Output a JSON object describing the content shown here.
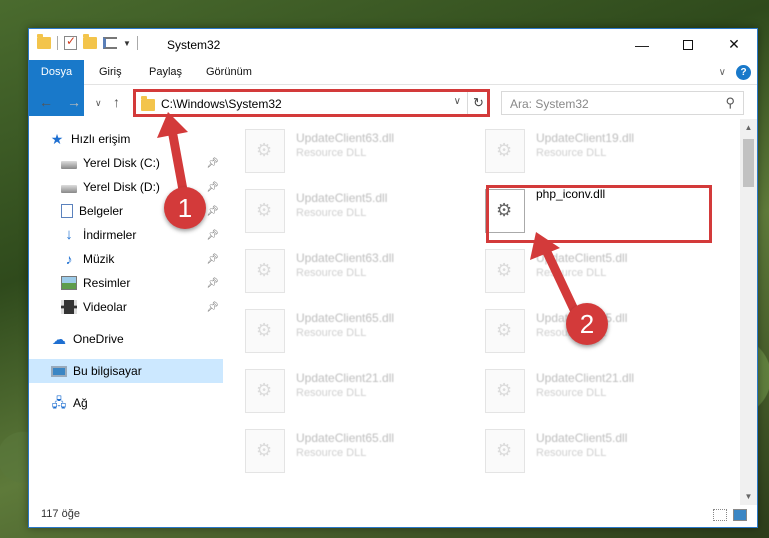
{
  "window": {
    "title": "System32",
    "controls": {
      "minimize": "—",
      "maximize": "",
      "close": "✕"
    }
  },
  "ribbon": {
    "tabs": [
      "Dosya",
      "Giriş",
      "Paylaş",
      "Görünüm"
    ],
    "help_label": "?"
  },
  "address": {
    "path": "C:\\Windows\\System32",
    "search_placeholder": "Ara: System32"
  },
  "sidebar": {
    "items": [
      {
        "label": "Hızlı erişim",
        "icon": "star-icon"
      },
      {
        "label": "Yerel Disk (C:)",
        "icon": "drive-icon",
        "pinned": true
      },
      {
        "label": "Yerel Disk (D:)",
        "icon": "drive-icon",
        "pinned": true
      },
      {
        "label": "Belgeler",
        "icon": "documents-icon",
        "pinned": true
      },
      {
        "label": "İndirmeler",
        "icon": "downloads-icon",
        "pinned": true
      },
      {
        "label": "Müzik",
        "icon": "music-icon",
        "pinned": true
      },
      {
        "label": "Resimler",
        "icon": "pictures-icon",
        "pinned": true
      },
      {
        "label": "Videolar",
        "icon": "videos-icon",
        "pinned": true
      },
      {
        "label": "OneDrive",
        "icon": "cloud-icon"
      },
      {
        "label": "Bu bilgisayar",
        "icon": "computer-icon",
        "selected": true
      },
      {
        "label": "Ağ",
        "icon": "network-icon"
      }
    ]
  },
  "files": {
    "left": [
      {
        "name": "UpdateClient63.dll",
        "type": "Resource DLL"
      },
      {
        "name": "UpdateClient5.dll",
        "type": "Resource DLL"
      },
      {
        "name": "UpdateClient63.dll",
        "type": "Resource DLL"
      },
      {
        "name": "UpdateClient65.dll",
        "type": "Resource DLL"
      },
      {
        "name": "UpdateClient21.dll",
        "type": "Resource DLL"
      },
      {
        "name": "UpdateClient65.dll",
        "type": "Resource DLL"
      }
    ],
    "right": [
      {
        "name": "UpdateClient19.dll",
        "type": "Resource DLL"
      },
      {
        "name": "php_iconv.dll",
        "type": "",
        "highlighted": true
      },
      {
        "name": "UpdateClient5.dll",
        "type": "Resource DLL"
      },
      {
        "name": "UpdateClient5.dll",
        "type": "Resource DLL"
      },
      {
        "name": "UpdateClient21.dll",
        "type": "Resource DLL"
      },
      {
        "name": "UpdateClient5.dll",
        "type": "Resource DLL"
      }
    ]
  },
  "status": {
    "item_count": "117 öğe"
  },
  "annotations": {
    "step1": "1",
    "step2": "2",
    "color": "#d33a3a"
  }
}
